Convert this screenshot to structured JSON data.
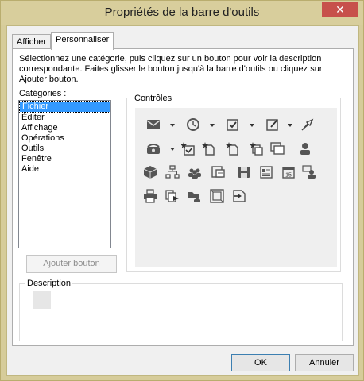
{
  "window": {
    "title": "Propriétés de la barre d'outils",
    "close_glyph": "✕"
  },
  "tabs": [
    {
      "label": "Afficher"
    },
    {
      "label": "Personnaliser"
    }
  ],
  "instructions": "Sélectionnez une catégorie, puis cliquez sur un bouton pour voir la description correspondante. Faites glisser le bouton jusqu'à la barre d'outils ou cliquez sur Ajouter bouton.",
  "categories": {
    "label": "Catégories :",
    "items": [
      "Fichier",
      "Éditer",
      "Affichage",
      "Opérations",
      "Outils",
      "Fenêtre",
      "Aide"
    ],
    "selected": "Fichier"
  },
  "add_button": "Ajouter bouton",
  "controls": {
    "label": "Contrôles",
    "icons": [
      "mail-dropdown-icon",
      "clock-dropdown-icon",
      "task-check-dropdown-icon",
      "note-edit-dropdown-icon",
      "pin-icon",
      "phone-dropdown-icon",
      "star-check-icon",
      "star-doc-icon",
      "star-doc-icon",
      "star-docs-icon",
      "windows-icon",
      "contact-icon",
      "box-icon",
      "org-chart-icon",
      "group-icon",
      "doc-image-icon",
      "save-icon",
      "address-card-icon",
      "calendar-icon",
      "contact-card-icon",
      "print-icon",
      "export-icon",
      "folder-contact-icon",
      "frame-icon",
      "arrow-doc-icon"
    ]
  },
  "description": {
    "label": "Description"
  },
  "buttons": {
    "ok": "OK",
    "cancel": "Annuler"
  }
}
